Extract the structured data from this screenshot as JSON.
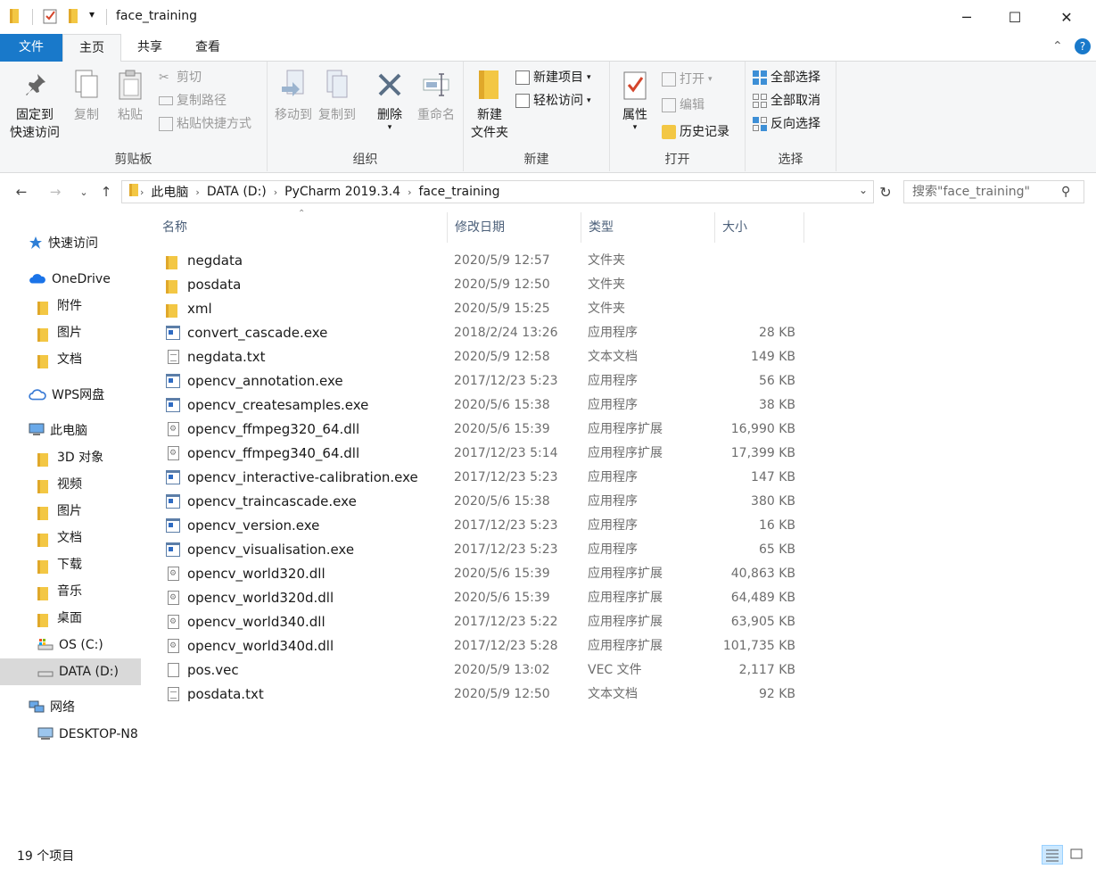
{
  "window": {
    "title": "face_training",
    "minimize_glyph": "─",
    "maximize_glyph": "☐",
    "close_glyph": "✕",
    "qat_dropdown_glyph": "▾"
  },
  "tabs": {
    "file": "文件",
    "home": "主页",
    "share": "共享",
    "view": "查看"
  },
  "ribbon": {
    "clipboard": {
      "label": "剪贴板",
      "pin_line1": "固定到",
      "pin_line2": "快速访问",
      "copy": "复制",
      "paste": "粘贴",
      "cut": "剪切",
      "copy_path": "复制路径",
      "paste_shortcut": "粘贴快捷方式"
    },
    "organize": {
      "label": "组织",
      "move_to": "移动到",
      "copy_to": "复制到",
      "delete": "删除",
      "rename": "重命名"
    },
    "new": {
      "label": "新建",
      "new_folder_line1": "新建",
      "new_folder_line2": "文件夹",
      "new_item": "新建项目",
      "easy_access": "轻松访问"
    },
    "open": {
      "label": "打开",
      "properties": "属性",
      "open": "打开",
      "edit": "编辑",
      "history": "历史记录"
    },
    "select": {
      "label": "选择",
      "select_all": "全部选择",
      "select_none": "全部取消",
      "invert": "反向选择"
    }
  },
  "address": {
    "crumbs": [
      "此电脑",
      "DATA (D:)",
      "PyCharm 2019.3.4",
      "face_training"
    ],
    "search_placeholder": "搜索\"face_training\""
  },
  "sidebar": {
    "items": [
      {
        "label": "快速访问",
        "icon": "star-icon",
        "indent": 0
      },
      {
        "label": "OneDrive",
        "icon": "cloud-icon",
        "indent": 0
      },
      {
        "label": "附件",
        "icon": "folder-icon",
        "indent": 1
      },
      {
        "label": "图片",
        "icon": "folder-icon",
        "indent": 1
      },
      {
        "label": "文档",
        "icon": "folder-icon",
        "indent": 1
      },
      {
        "label": "WPS网盘",
        "icon": "wps-cloud-icon",
        "indent": 0
      },
      {
        "label": "此电脑",
        "icon": "computer-icon",
        "indent": 0
      },
      {
        "label": "3D 对象",
        "icon": "3d-objects-icon",
        "indent": 1
      },
      {
        "label": "视频",
        "icon": "video-icon",
        "indent": 1
      },
      {
        "label": "图片",
        "icon": "pictures-icon",
        "indent": 1
      },
      {
        "label": "文档",
        "icon": "documents-icon",
        "indent": 1
      },
      {
        "label": "下载",
        "icon": "download-icon",
        "indent": 1
      },
      {
        "label": "音乐",
        "icon": "music-icon",
        "indent": 1
      },
      {
        "label": "桌面",
        "icon": "desktop-icon",
        "indent": 1
      },
      {
        "label": "OS (C:)",
        "icon": "os-drive-icon",
        "indent": 1
      },
      {
        "label": "DATA (D:)",
        "icon": "drive-icon",
        "indent": 1,
        "selected": true
      },
      {
        "label": "网络",
        "icon": "network-icon",
        "indent": 0
      },
      {
        "label": "DESKTOP-N8",
        "icon": "pc-icon",
        "indent": 1
      }
    ]
  },
  "columns": {
    "name": "名称",
    "date": "修改日期",
    "type": "类型",
    "size": "大小"
  },
  "files": [
    {
      "name": "negdata",
      "date": "2020/5/9 12:57",
      "type": "文件夹",
      "size": "",
      "kind": "folder"
    },
    {
      "name": "posdata",
      "date": "2020/5/9 12:50",
      "type": "文件夹",
      "size": "",
      "kind": "folder"
    },
    {
      "name": "xml",
      "date": "2020/5/9 15:25",
      "type": "文件夹",
      "size": "",
      "kind": "folder"
    },
    {
      "name": "convert_cascade.exe",
      "date": "2018/2/24 13:26",
      "type": "应用程序",
      "size": "28 KB",
      "kind": "exe"
    },
    {
      "name": "negdata.txt",
      "date": "2020/5/9 12:58",
      "type": "文本文档",
      "size": "149 KB",
      "kind": "txt"
    },
    {
      "name": "opencv_annotation.exe",
      "date": "2017/12/23 5:23",
      "type": "应用程序",
      "size": "56 KB",
      "kind": "exe"
    },
    {
      "name": "opencv_createsamples.exe",
      "date": "2020/5/6 15:38",
      "type": "应用程序",
      "size": "38 KB",
      "kind": "exe"
    },
    {
      "name": "opencv_ffmpeg320_64.dll",
      "date": "2020/5/6 15:39",
      "type": "应用程序扩展",
      "size": "16,990 KB",
      "kind": "dll"
    },
    {
      "name": "opencv_ffmpeg340_64.dll",
      "date": "2017/12/23 5:14",
      "type": "应用程序扩展",
      "size": "17,399 KB",
      "kind": "dll"
    },
    {
      "name": "opencv_interactive-calibration.exe",
      "date": "2017/12/23 5:23",
      "type": "应用程序",
      "size": "147 KB",
      "kind": "exe"
    },
    {
      "name": "opencv_traincascade.exe",
      "date": "2020/5/6 15:38",
      "type": "应用程序",
      "size": "380 KB",
      "kind": "exe"
    },
    {
      "name": "opencv_version.exe",
      "date": "2017/12/23 5:23",
      "type": "应用程序",
      "size": "16 KB",
      "kind": "exe"
    },
    {
      "name": "opencv_visualisation.exe",
      "date": "2017/12/23 5:23",
      "type": "应用程序",
      "size": "65 KB",
      "kind": "exe"
    },
    {
      "name": "opencv_world320.dll",
      "date": "2020/5/6 15:39",
      "type": "应用程序扩展",
      "size": "40,863 KB",
      "kind": "dll"
    },
    {
      "name": "opencv_world320d.dll",
      "date": "2020/5/6 15:39",
      "type": "应用程序扩展",
      "size": "64,489 KB",
      "kind": "dll"
    },
    {
      "name": "opencv_world340.dll",
      "date": "2017/12/23 5:22",
      "type": "应用程序扩展",
      "size": "63,905 KB",
      "kind": "dll"
    },
    {
      "name": "opencv_world340d.dll",
      "date": "2017/12/23 5:28",
      "type": "应用程序扩展",
      "size": "101,735 KB",
      "kind": "dll"
    },
    {
      "name": "pos.vec",
      "date": "2020/5/9 13:02",
      "type": "VEC 文件",
      "size": "2,117 KB",
      "kind": "vec"
    },
    {
      "name": "posdata.txt",
      "date": "2020/5/9 12:50",
      "type": "文本文档",
      "size": "92 KB",
      "kind": "txt"
    }
  ],
  "status": {
    "item_count": "19 个项目"
  },
  "colors": {
    "accent": "#1979ca",
    "folder": "#f3c744",
    "selection": "#cce8ff"
  }
}
